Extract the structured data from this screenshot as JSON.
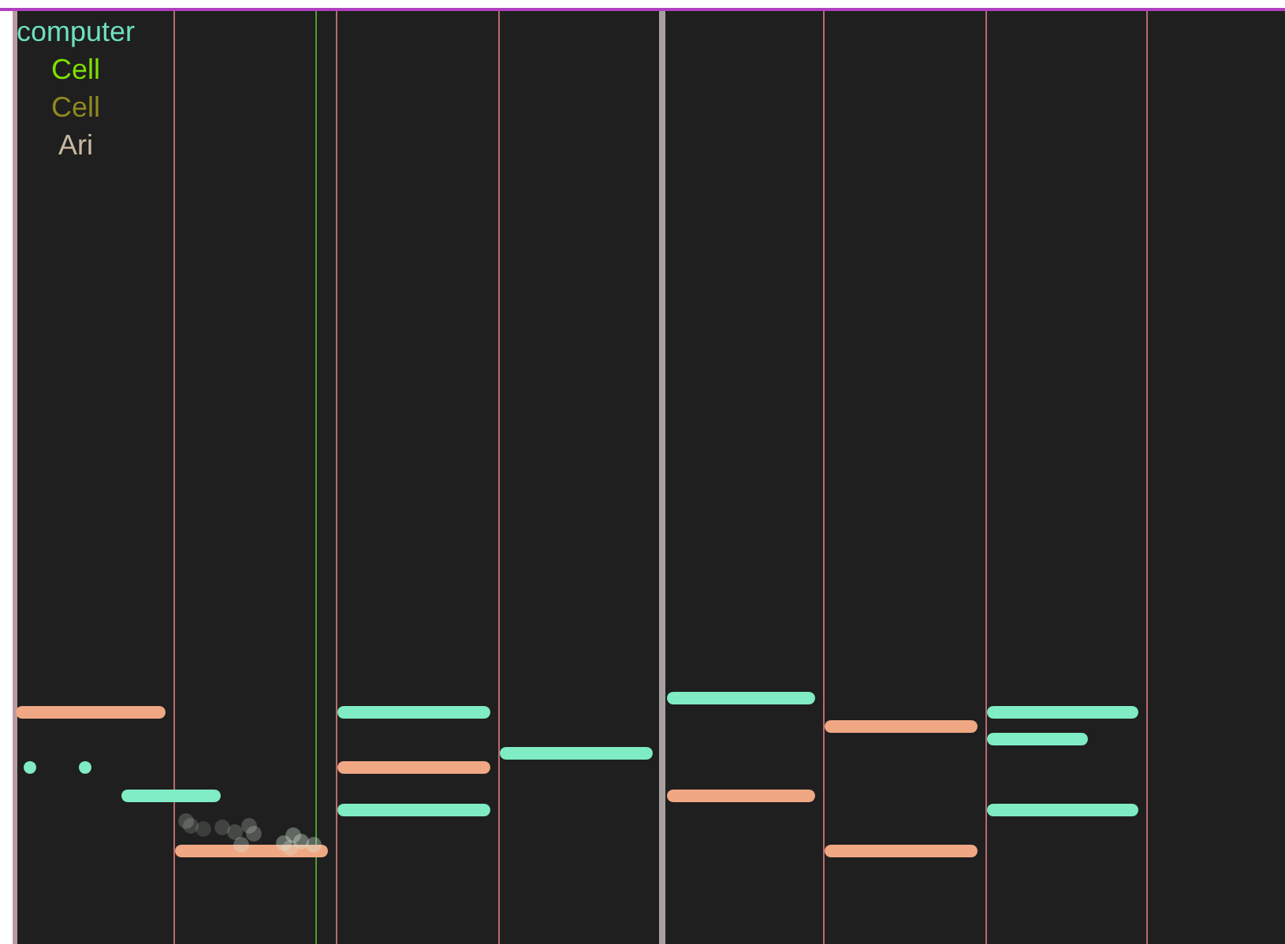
{
  "legend": [
    {
      "label": "computer",
      "color": "#6ee0c0"
    },
    {
      "label": "Cell",
      "color": "#7fe000"
    },
    {
      "label": "Cell",
      "color": "#8f8a20"
    },
    {
      "label": "Ari",
      "color": "#c8b8a0"
    }
  ]
}
